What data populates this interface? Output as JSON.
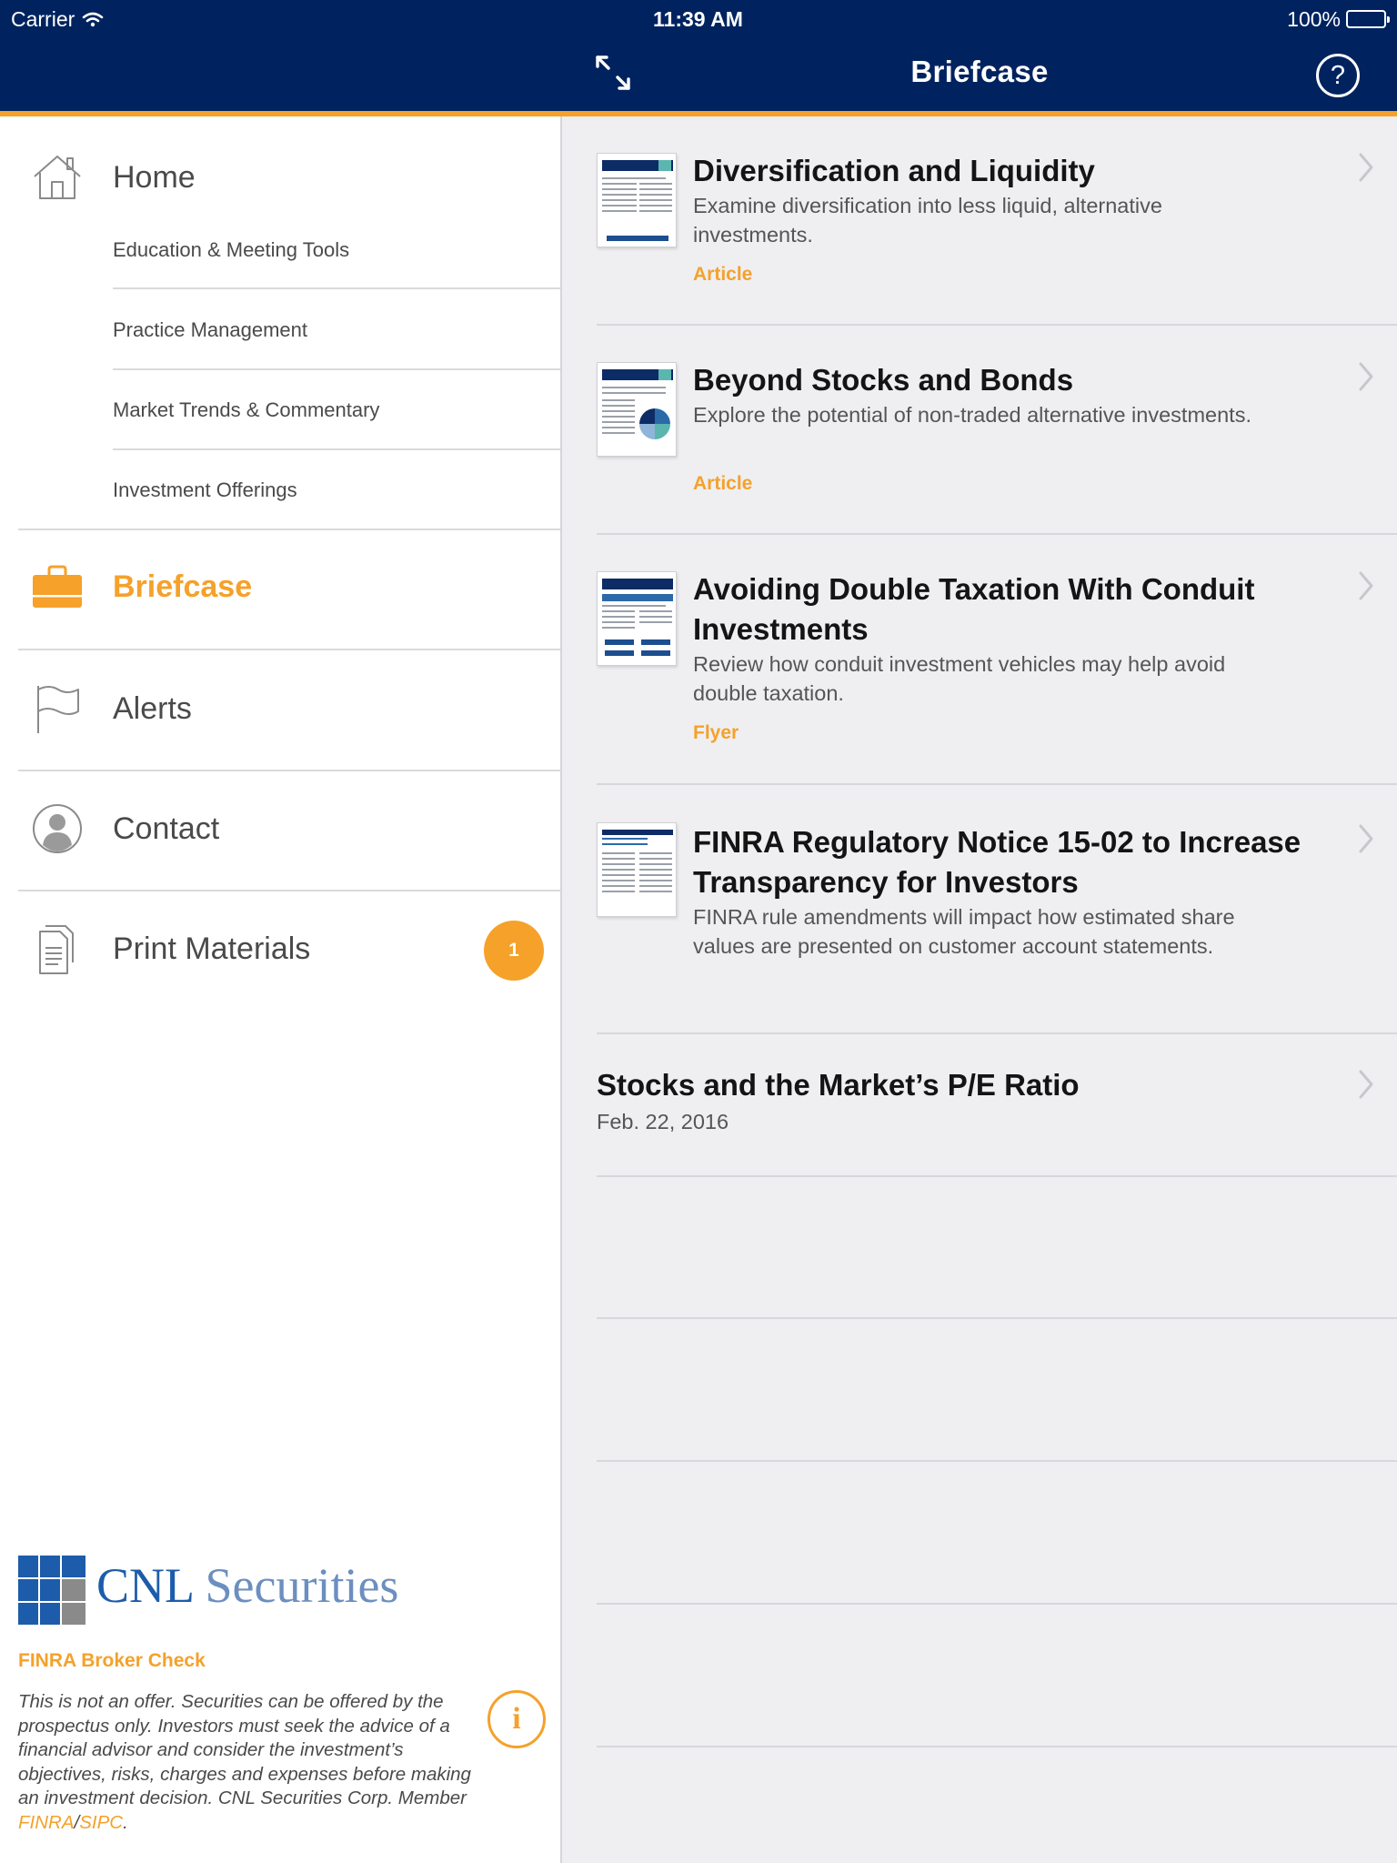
{
  "status_bar": {
    "carrier": "Carrier",
    "time": "11:39 AM",
    "battery": "100%"
  },
  "header": {
    "title": "Briefcase"
  },
  "sidebar": {
    "home": {
      "label": "Home",
      "icon": "home-icon"
    },
    "sub_items": [
      {
        "label": "Education & Meeting Tools"
      },
      {
        "label": "Practice Management"
      },
      {
        "label": "Market Trends & Commentary"
      },
      {
        "label": "Investment Offerings"
      }
    ],
    "briefcase": {
      "label": "Briefcase",
      "icon": "briefcase-icon"
    },
    "alerts": {
      "label": "Alerts",
      "icon": "flag-icon"
    },
    "contact": {
      "label": "Contact",
      "icon": "person-icon"
    },
    "print": {
      "label": "Print Materials",
      "icon": "document-icon",
      "badge": "1"
    },
    "logo": {
      "cnl": "CNL",
      "securities": "Securities"
    },
    "broker_check": "FINRA Broker Check",
    "disclaimer": {
      "body": "This is not an offer. Securities can be offered by the prospectus only. Investors must seek the advice of a financial advisor and consider the investment’s objectives, risks, charges and expenses before making an investment decision. CNL Securities Corp. Member ",
      "finra": "FINRA",
      "slash": "/",
      "sipc": "SIPC",
      "end": "."
    }
  },
  "briefcase_items": [
    {
      "title": "Diversification and Liquidity",
      "description": "Examine diversification into less liquid, alternative investments.",
      "type": "Article"
    },
    {
      "title": "Beyond Stocks and Bonds",
      "description": "Explore the potential of non-traded alternative investments.",
      "type": "Article"
    },
    {
      "title": "Avoiding Double Taxation With Conduit Investments",
      "description": "Review how conduit investment vehicles may help avoid double taxation.",
      "type": "Flyer"
    },
    {
      "title": "FINRA Regulatory Notice 15-02 to Increase Transparency for Investors",
      "description": "FINRA rule amendments will impact how estimated share values are presented on customer account statements.",
      "type": ""
    },
    {
      "title": "Stocks and the Market’s P/E Ratio",
      "date": "Feb. 22, 2016"
    }
  ],
  "colors": {
    "navy": "#00235f",
    "accent": "#f5a12a",
    "background": "#efeff2"
  }
}
